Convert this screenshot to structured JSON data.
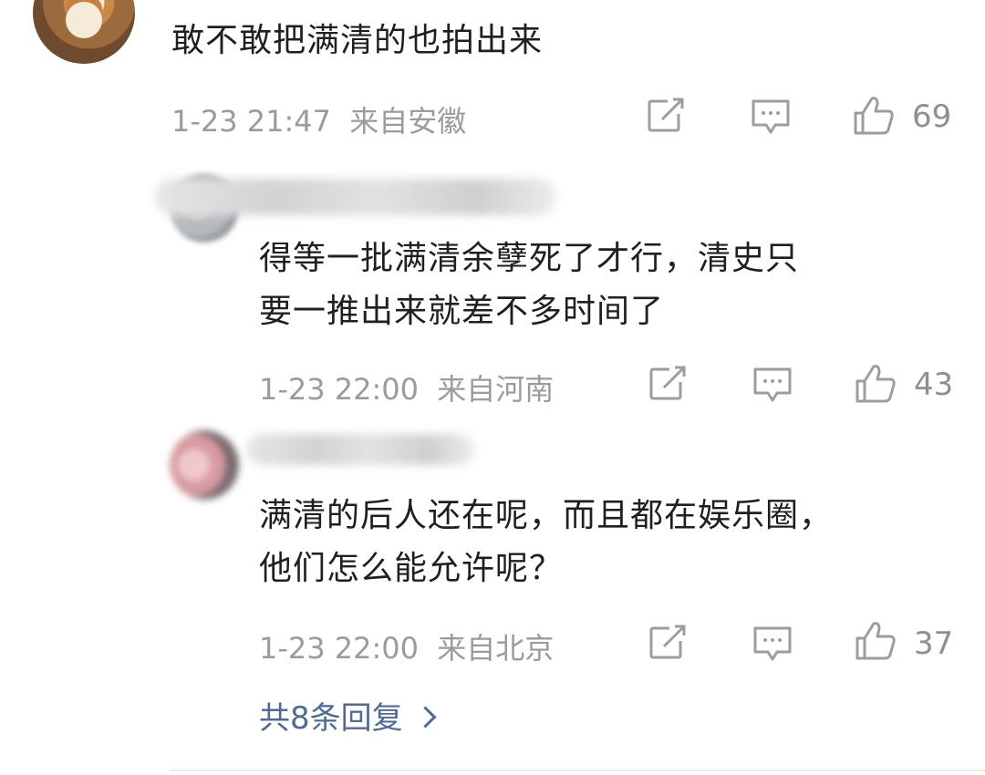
{
  "main_comment": {
    "text": "敢不敢把满清的也拍出来",
    "time": "1-23 21:47",
    "location": "来自安徽",
    "like_count": "69"
  },
  "replies": [
    {
      "line1": "得等一批满清余孽死了才行，清史只",
      "line2": "要一推出来就差不多时间了",
      "time": "1-23 22:00",
      "location": "来自河南",
      "like_count": "43"
    },
    {
      "line1": "满清的后人还在呢，而且都在娱乐圈，",
      "line2": "他们怎么能允许呢？",
      "time": "1-23 22:00",
      "location": "来自北京",
      "like_count": "37"
    }
  ],
  "more_replies_label": "共8条回复",
  "icons": {
    "share": "share-icon",
    "comment": "comment-icon",
    "like": "thumbs-up-icon",
    "more": "chevron-right-icon"
  },
  "colors": {
    "text": "#1f1f1f",
    "meta": "#9b9b9b",
    "link": "#4f6a96"
  }
}
